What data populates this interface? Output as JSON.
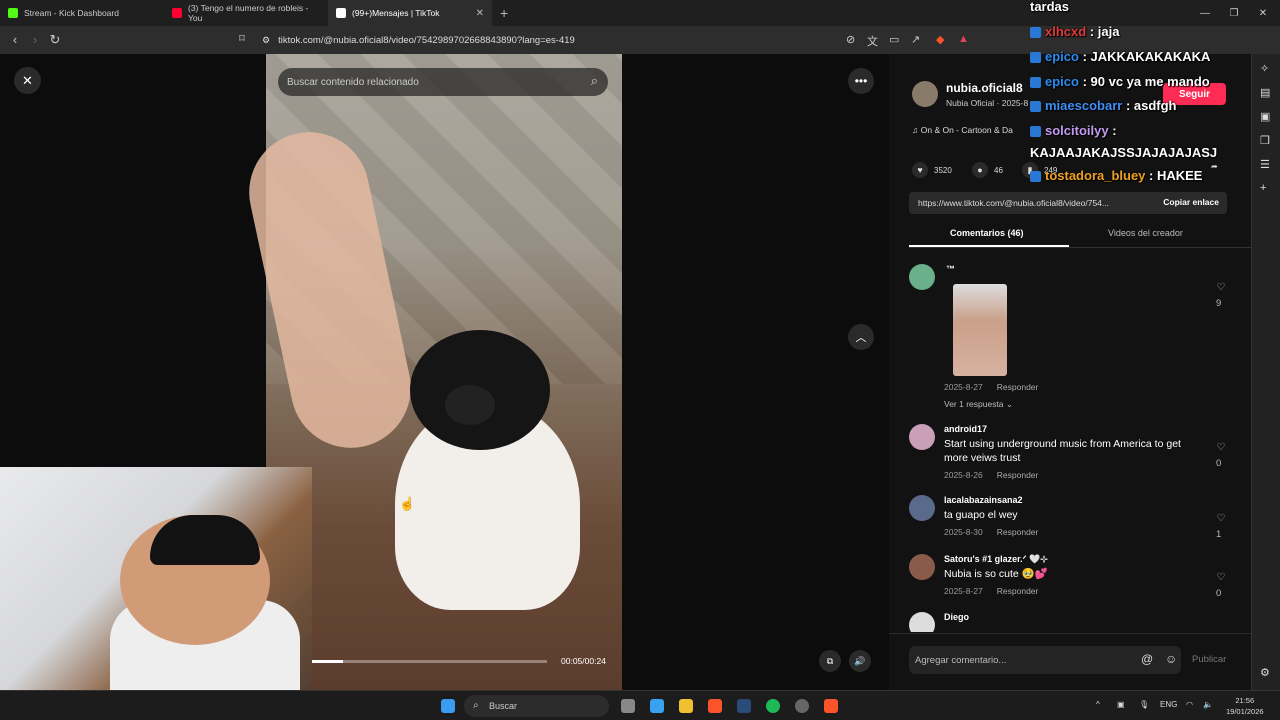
{
  "browser": {
    "tabs": [
      {
        "label": "Stream - Kick Dashboard",
        "color": "#53fc18"
      },
      {
        "label": "(3) Tengo el numero de robleis - You",
        "color": "#ff0033"
      },
      {
        "label": "(99+)Mensajes | TikTok",
        "color": "#ffffff"
      }
    ],
    "new_tab": "+",
    "url": "tiktok.com/@nubia.oficial8/video/7542989702668843890?lang=es-419"
  },
  "video": {
    "search_placeholder": "Buscar contenido relacionado",
    "time": "00:05/00:24",
    "progress": 0.13
  },
  "panel": {
    "author_name": "nubia.oficial8",
    "author_sub": "Nubia Oficial · 2025-8",
    "music": "On & On - Cartoon & Da",
    "follow": "Seguir",
    "likes": "3520",
    "comments_count": "46",
    "saves": "249",
    "link": "https://www.tiktok.com/@nubia.oficial8/video/754...",
    "copy_link": "Copiar enlace",
    "tab_comments": "Comentarios (46)",
    "tab_creator": "Videos del creador",
    "view_replies": "Ver 1 respuesta",
    "add_comment_placeholder": "Agregar comentario...",
    "publish": "Publicar",
    "comments": [
      {
        "name": "™",
        "text": "",
        "date": "2025-8-27",
        "reply": "Responder",
        "likes": "9"
      },
      {
        "name": "android17",
        "text": "Start using underground music from America to get more veiws trust",
        "date": "2025-8-26",
        "reply": "Responder",
        "likes": "0"
      },
      {
        "name": "lacalabazainsana2",
        "text": "ta guapo el wey",
        "date": "2025-8-30",
        "reply": "Responder",
        "likes": "1"
      },
      {
        "name": "Satoru's #1 glazer.ᐟ 🤍⊹",
        "text": "Nubia is so cute 🥹💕",
        "date": "2025-8-27",
        "reply": "Responder",
        "likes": "0"
      },
      {
        "name": "Diego",
        "text": "",
        "date": "",
        "reply": "",
        "likes": ""
      }
    ]
  },
  "chat": [
    {
      "user": "",
      "msg": "tardas",
      "color": "#ffffff"
    },
    {
      "user": "xlhcxd",
      "msg": " : jaja",
      "color": "#e03a3a"
    },
    {
      "user": "epico",
      "msg": " : JAKKAKAKAKAKA",
      "color": "#2a8cf0"
    },
    {
      "user": "epico",
      "msg": " : 90 vc ya me mando",
      "color": "#2a8cf0"
    },
    {
      "user": "miaescobarr",
      "msg": " : asdfgh",
      "color": "#3f8ef5"
    },
    {
      "user": "solcitoilyy",
      "msg": " :",
      "color": "#c39bf0"
    },
    {
      "user": "",
      "msg": "KAJAAJAKAJSSJAJAJAJASJ",
      "color": "#ffffff"
    },
    {
      "user": "tostadora_bluey",
      "msg": " : HAKEE",
      "color": "#f0a020"
    }
  ],
  "taskbar": {
    "search": "Buscar",
    "lang": "ENG",
    "time": "21:56",
    "date": "19/01/2026"
  }
}
